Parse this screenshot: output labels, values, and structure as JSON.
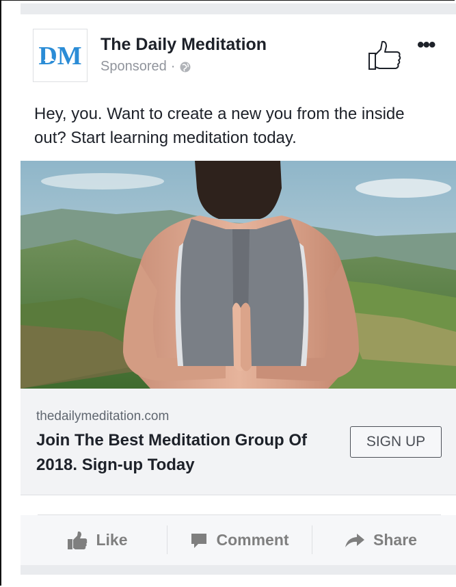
{
  "post": {
    "page_name": "The Daily Meditation",
    "sponsored_label": "Sponsored",
    "separator": "·",
    "logo_text": "DM",
    "body_text": "Hey, you. Want to create a new you from the inside out? Start learning meditation today."
  },
  "link_preview": {
    "domain": "thedailymeditation.com",
    "headline": "Join The Best Meditation Group Of 2018. Sign-up Today",
    "cta_label": "SIGN UP"
  },
  "actions": {
    "like_label": "Like",
    "comment_label": "Comment",
    "share_label": "Share"
  },
  "header_actions": {
    "more_label": "•••"
  },
  "colors": {
    "brand_blue": "#2b8cd6",
    "text_primary": "#1d2129",
    "text_secondary": "#90949c",
    "action_gray": "#7f7f7f"
  }
}
